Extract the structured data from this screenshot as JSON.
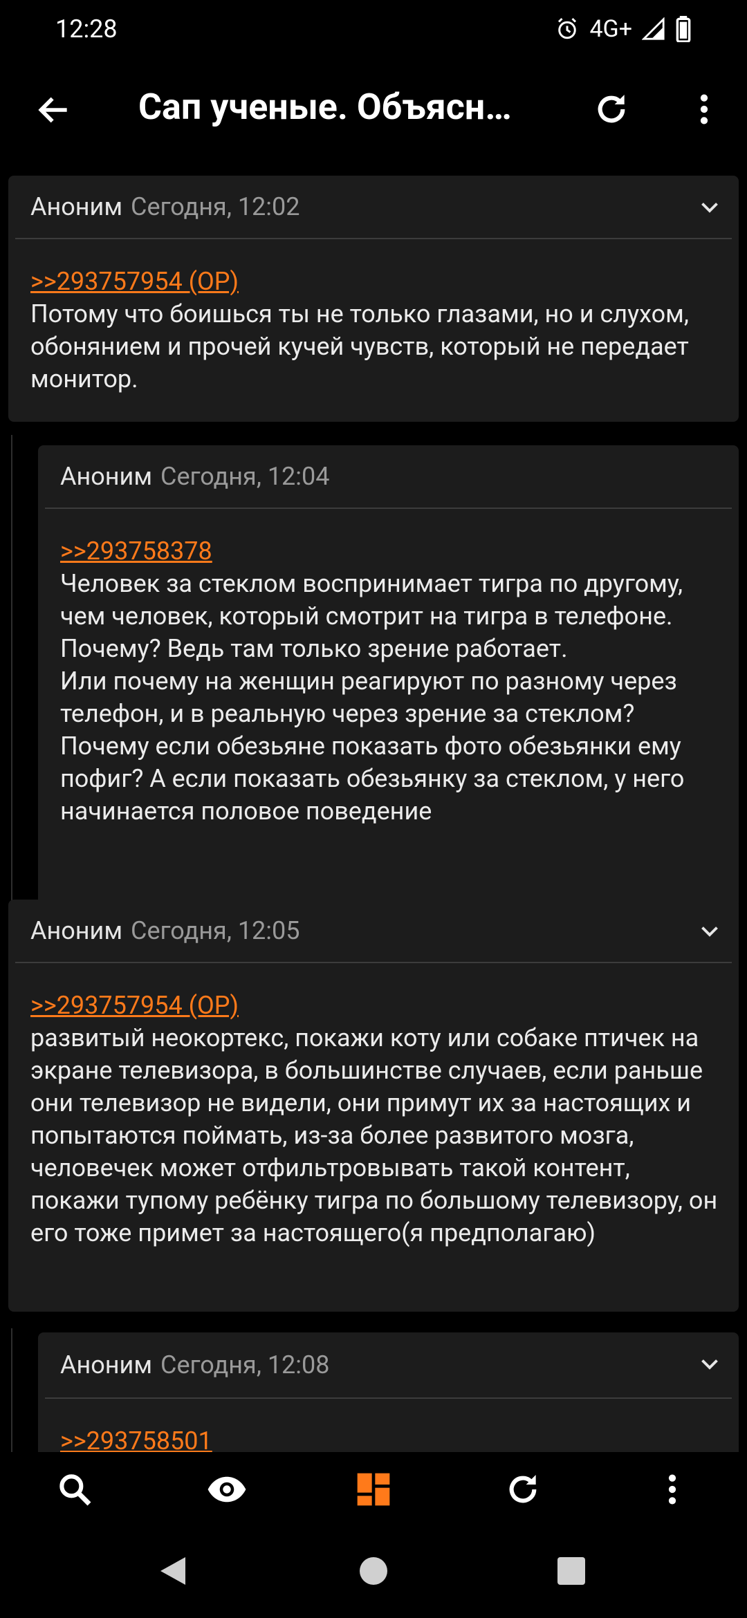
{
  "status_bar": {
    "time": "12:28",
    "network": "4G+",
    "icons": [
      "alarm-icon",
      "signal-icon",
      "battery-icon"
    ]
  },
  "app_bar": {
    "title": "Сап ученые. Объясн…",
    "icons": [
      "back-arrow-icon",
      "refresh-icon",
      "more-vert-icon"
    ]
  },
  "posts": [
    {
      "author": "Аноним",
      "date": "Сегодня, 12:02",
      "reply_to": ">>293757954 (OP)",
      "text": "Потому что боишься ты не только глазами, но и слухом, обонянием и прочей кучей чувств, который не передает монитор."
    },
    {
      "author": "Аноним",
      "date": "Сегодня, 12:04",
      "reply_to": ">>293758378",
      "text_lines": [
        "Человек за стеклом воспринимает тигра по другому, чем человек, который смотрит на тигра в телефоне. Почему? Ведь там только зрение работает.",
        "Или почему на женщин реагируют по разному через телефон, и в реальную через зрение за стеклом? Почему если обезьяне показать фото обезьянки ему пофиг? А если показать обезьянку за стеклом, у него начинается половое поведение"
      ]
    },
    {
      "author": "Аноним",
      "date": "Сегодня, 12:05",
      "reply_to": ">>293757954 (OP)",
      "text": "развитый неокортекс, покажи коту или собаке птичек на экране телевизора, в большинстве случаев, если раньше они телевизор не видели, они примут их за настоящих и попытаются поймать, из-за более развитого мозга, человечек может отфильтровывать такой контент, покажи тупому ребёнку тигра по большому телевизору, он его тоже примет за настоящего(я предполагаю)"
    },
    {
      "author": "Аноним",
      "date": "Сегодня, 12:08",
      "reply_to": ">>293758501"
    }
  ],
  "bottom_nav": {
    "icons": [
      "search-icon",
      "eye-icon",
      "dashboard-icon",
      "refresh-icon",
      "more-vert-icon"
    ],
    "active_color": "#ff7a1a"
  },
  "system_nav": {
    "icons": [
      "back-triangle-icon",
      "home-circle-icon",
      "recents-square-icon"
    ]
  },
  "colors": {
    "background": "#000000",
    "card": "#1c1c1c",
    "accent": "#ff7a1a",
    "muted_text": "#9a9a9a"
  }
}
